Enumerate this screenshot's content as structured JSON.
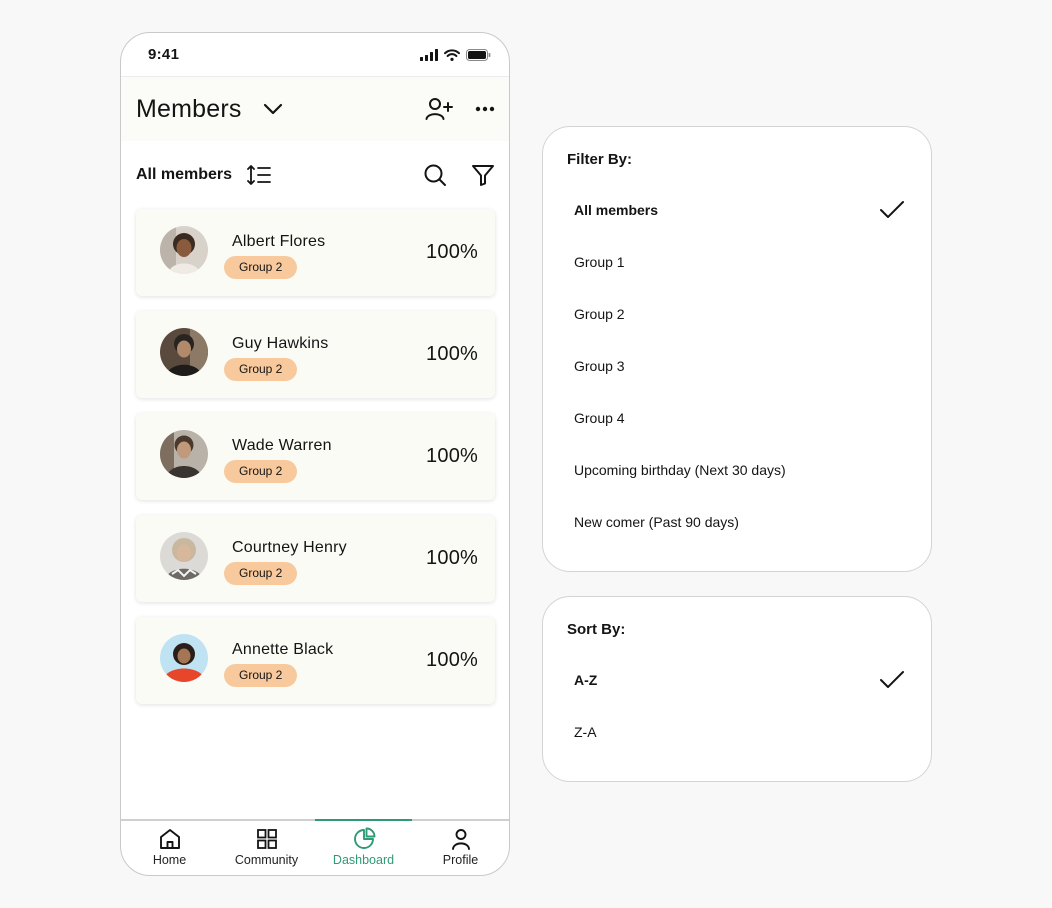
{
  "status": {
    "time": "9:41"
  },
  "header": {
    "title": "Members"
  },
  "toolbar": {
    "label": "All members"
  },
  "members": [
    {
      "name": "Albert Flores",
      "group": "Group 2",
      "percent": "100%"
    },
    {
      "name": "Guy Hawkins",
      "group": "Group 2",
      "percent": "100%"
    },
    {
      "name": "Wade Warren",
      "group": "Group 2",
      "percent": "100%"
    },
    {
      "name": "Courtney Henry",
      "group": "Group 2",
      "percent": "100%"
    },
    {
      "name": "Annette Black",
      "group": "Group 2",
      "percent": "100%"
    }
  ],
  "tabs": [
    {
      "label": "Home",
      "icon": "home-icon"
    },
    {
      "label": "Community",
      "icon": "grid-icon"
    },
    {
      "label": "Dashboard",
      "icon": "pie-chart-icon",
      "active": true
    },
    {
      "label": "Profile",
      "icon": "user-icon"
    }
  ],
  "filter": {
    "title": "Filter By:",
    "options": [
      {
        "label": "All members",
        "selected": true
      },
      {
        "label": "Group 1"
      },
      {
        "label": "Group 2"
      },
      {
        "label": "Group 3"
      },
      {
        "label": "Group 4"
      },
      {
        "label": "Upcoming birthday (Next 30 days)"
      },
      {
        "label": "New comer (Past 90 days)"
      }
    ]
  },
  "sort": {
    "title": "Sort By:",
    "options": [
      {
        "label": "A-Z",
        "selected": true
      },
      {
        "label": "Z-A"
      }
    ]
  },
  "colors": {
    "accent": "#2f9a76",
    "badge": "#f8c99c",
    "card": "#fbfbf6",
    "header_bg": "#fbfbf7"
  }
}
